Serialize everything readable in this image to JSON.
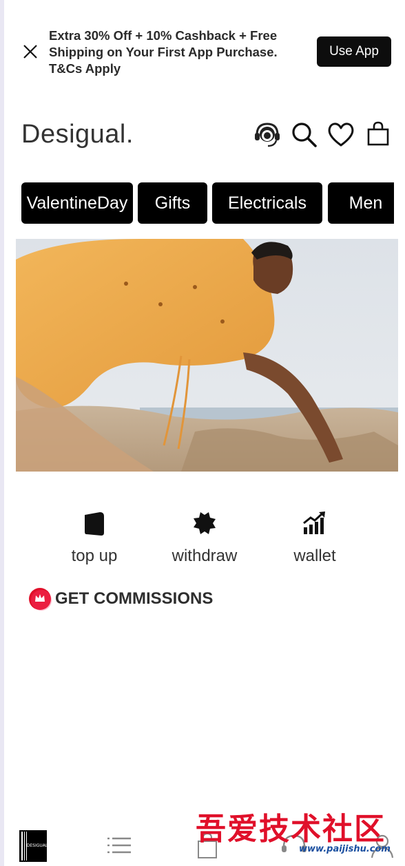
{
  "promo": {
    "line1": "Extra 30% Off + 10% Cashback + Free",
    "line2": "Shipping on Your First App Purchase.",
    "line3": "T&Cs Apply",
    "button": "Use App"
  },
  "header": {
    "logo": "Desigual.",
    "icons": [
      "support-headset-icon",
      "search-icon",
      "heart-icon",
      "bag-icon"
    ]
  },
  "categories": [
    "ValentineDay",
    "Gifts",
    "Electricals",
    "Men"
  ],
  "quick_actions": [
    {
      "label": "top up",
      "icon": "wallet-card-icon"
    },
    {
      "label": "withdraw",
      "icon": "gear-splat-icon"
    },
    {
      "label": "wallet",
      "icon": "growth-chart-icon"
    }
  ],
  "commission": {
    "label": "GET COMMISSIONS",
    "icon": "crown-badge-icon"
  },
  "bottom_nav": [
    "home-logo-icon",
    "menu-list-icon",
    "bag-icon",
    "support-icon",
    "account-icon"
  ],
  "bottom_logo_text": "DESIGUAL",
  "watermark": {
    "text": "吾爱技术社区",
    "url": "www.paijishu.com"
  },
  "colors": {
    "accent": "#000000",
    "badge": "#e0102a",
    "watermark": "#e0102a"
  }
}
